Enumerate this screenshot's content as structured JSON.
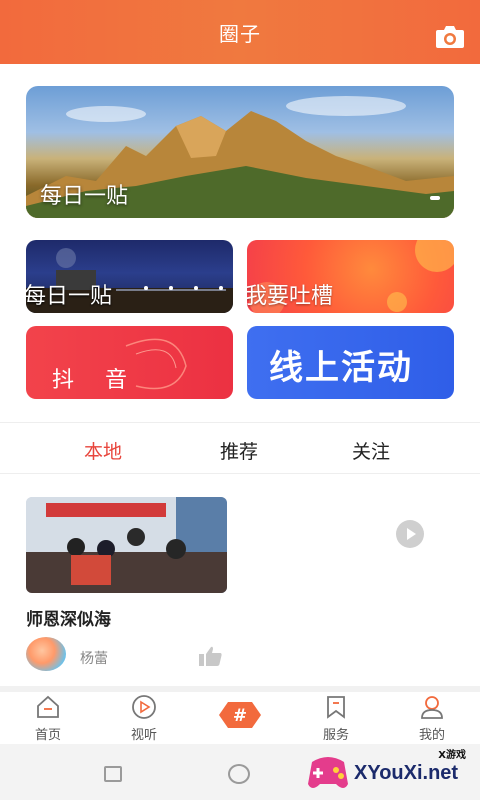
{
  "header": {
    "title": "圈子",
    "camera_icon": "camera-icon"
  },
  "banner": {
    "label": "每日一贴"
  },
  "tiles": [
    {
      "label": "每日一贴"
    },
    {
      "label": "我要吐槽"
    },
    {
      "label": "抖 音"
    },
    {
      "label": "线上活动"
    }
  ],
  "tabs": [
    {
      "label": "本地",
      "active": true
    },
    {
      "label": "推荐",
      "active": false
    },
    {
      "label": "关注",
      "active": false
    }
  ],
  "post": {
    "title": "师恩深似海",
    "author": "杨蕾",
    "image_banner_text": ""
  },
  "bottom_nav": [
    {
      "label": "首页",
      "icon": "home-icon"
    },
    {
      "label": "视听",
      "icon": "play-icon"
    },
    {
      "label": "#",
      "icon": "hashtag-icon"
    },
    {
      "label": "服务",
      "icon": "bookmark-icon"
    },
    {
      "label": "我的",
      "icon": "profile-icon"
    }
  ],
  "watermark": {
    "small": "X游戏",
    "big": "XYouXi.net"
  },
  "colors": {
    "accent": "#e8453c",
    "header": "#f26a3d",
    "blue_tile": "#2f5ee8",
    "red_tile": "#ec3142"
  }
}
